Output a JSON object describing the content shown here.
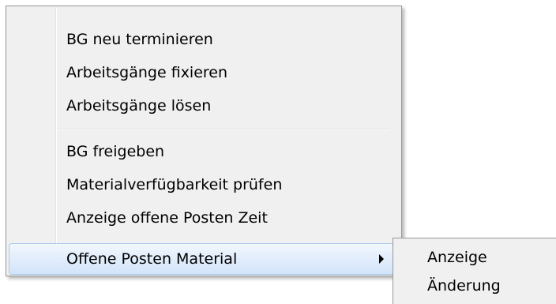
{
  "context_menu": {
    "items": [
      {
        "label": "BG neu terminieren"
      },
      {
        "label": "Arbeitsgänge fixieren"
      },
      {
        "label": "Arbeitsgänge lösen"
      },
      {
        "label": "BG freigeben"
      },
      {
        "label": "Materialverfügbarkeit prüfen"
      },
      {
        "label": "Anzeige offene Posten Zeit"
      },
      {
        "label": "Offene Posten Material",
        "has_submenu": true,
        "highlighted": true
      }
    ],
    "highlight_color": "#d3e5fa",
    "highlight_border": "#a8c8ed",
    "background": "#f0f0f0"
  },
  "submenu": {
    "items": [
      {
        "label": "Anzeige"
      },
      {
        "label": "Änderung"
      }
    ]
  }
}
